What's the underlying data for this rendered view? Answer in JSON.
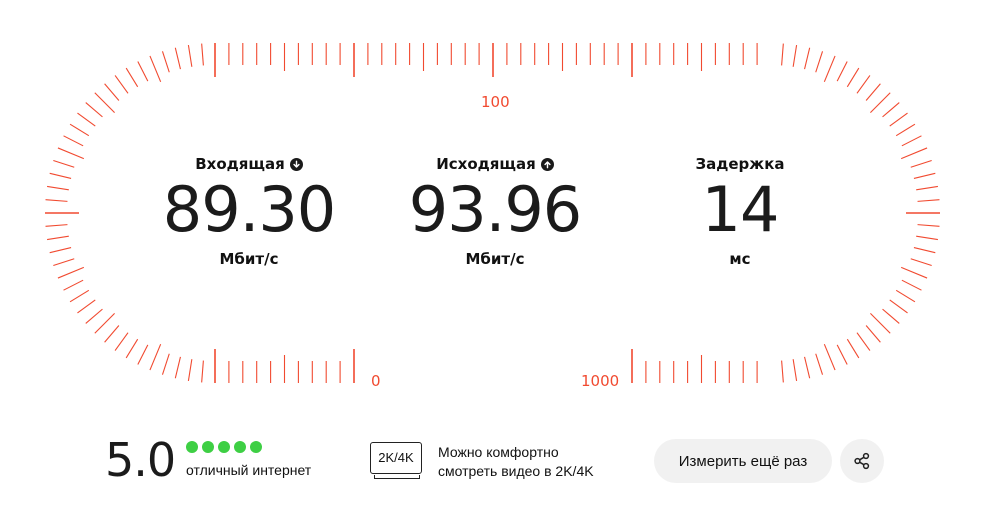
{
  "gauge": {
    "accent_color": "#f14a30",
    "scale_labels": {
      "top": "100",
      "bottom_left": "0",
      "bottom_right": "1000"
    }
  },
  "metrics": {
    "download": {
      "title": "Входящая",
      "value": "89.30",
      "unit": "Мбит/с",
      "icon": "arrow-down-icon"
    },
    "upload": {
      "title": "Исходящая",
      "value": "93.96",
      "unit": "Мбит/с",
      "icon": "arrow-up-icon"
    },
    "latency": {
      "title": "Задержка",
      "value": "14",
      "unit": "мс"
    }
  },
  "rating": {
    "score": "5.0",
    "stars_filled": 5,
    "stars_total": 5,
    "dot_color": "#3ecf44",
    "label": "отличный интернет"
  },
  "quality": {
    "badge": "2K/4K",
    "line1": "Можно комфортно",
    "line2": "смотреть видео в 2K/4K"
  },
  "actions": {
    "retry_label": "Измерить ещё раз",
    "share_icon": "share-icon"
  }
}
